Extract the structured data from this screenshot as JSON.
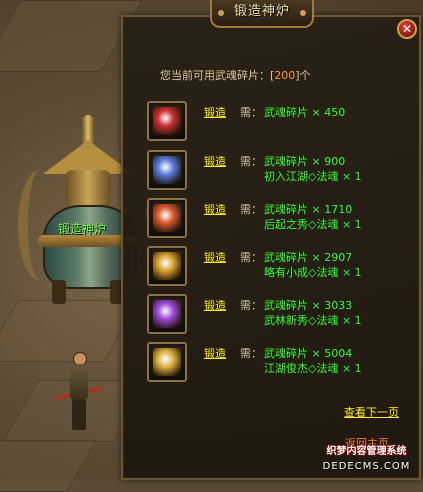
{
  "world": {
    "cauldron_label": "锻造神炉"
  },
  "dialog": {
    "title": "锻造神炉",
    "close_glyph": "✕",
    "fragments_prefix": "您当前可用武魂碎片：",
    "fragments_open": "[",
    "fragments_value": "200",
    "fragments_close": "]个",
    "items": [
      {
        "icon": "dagger-icon",
        "color": "#c83030",
        "forge": "锻造",
        "need": "需：",
        "req1": "武魂碎片 × 450",
        "req2": ""
      },
      {
        "icon": "shield-crest-icon",
        "color": "#5a78d8",
        "forge": "锻造",
        "need": "需：",
        "req1": "武魂碎片 × 900",
        "req2": "初入江湖◇法魂 × 1"
      },
      {
        "icon": "rune-diamond-icon",
        "color": "#d85a30",
        "forge": "锻造",
        "need": "需：",
        "req1": "武魂碎片 × 1710",
        "req2": "后起之秀◇法魂 × 1"
      },
      {
        "icon": "swirl-emblem-icon",
        "color": "#d8a030",
        "forge": "锻造",
        "need": "需：",
        "req1": "武魂碎片 × 2907",
        "req2": "略有小成◇法魂 × 1"
      },
      {
        "icon": "violet-orb-icon",
        "color": "#a048d8",
        "forge": "锻造",
        "need": "需：",
        "req1": "武魂碎片 × 3033",
        "req2": "武林新秀◇法魂 × 1"
      },
      {
        "icon": "dragon-orb-icon",
        "color": "#e0b040",
        "forge": "锻造",
        "need": "需：",
        "req1": "武魂碎片 × 5004",
        "req2": "江湖俊杰◇法魂 × 1"
      }
    ],
    "next_page": "查看下一页",
    "return_main": "返回主页"
  },
  "watermark": {
    "line1": "织梦内容管理系统",
    "line2": "DEDECMS.COM"
  }
}
